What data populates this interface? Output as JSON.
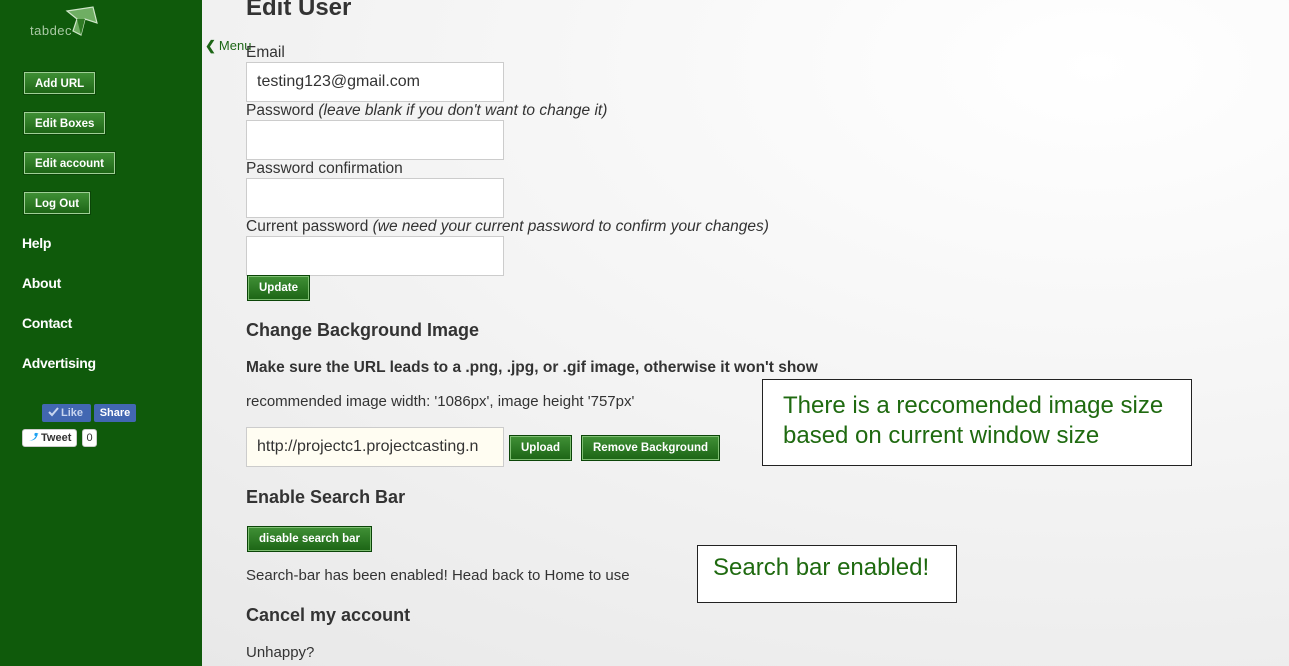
{
  "brand": {
    "logo_text": "tabdec"
  },
  "sidebar": {
    "buttons": [
      {
        "label": "Add URL"
      },
      {
        "label": "Edit Boxes"
      },
      {
        "label": "Edit account"
      },
      {
        "label": "Log Out"
      }
    ],
    "links": [
      {
        "label": "Help"
      },
      {
        "label": "About"
      },
      {
        "label": "Contact"
      },
      {
        "label": "Advertising"
      }
    ],
    "social": {
      "like_label": "Like",
      "share_label": "Share",
      "tweet_label": "Tweet",
      "tweet_count": "0"
    },
    "menu_toggle": {
      "chevron": "❮",
      "label": "Menu"
    }
  },
  "page": {
    "title": "Edit User",
    "email": {
      "label": "Email",
      "value": "testing123@gmail.com"
    },
    "password": {
      "label": "Password",
      "hint": "(leave blank if you don't want to change it)",
      "value": ""
    },
    "password_confirmation": {
      "label": "Password confirmation",
      "value": ""
    },
    "current_password": {
      "label": "Current password",
      "hint": "(we need your current password to confirm your changes)",
      "value": ""
    },
    "update_button": "Update"
  },
  "background": {
    "heading": "Change Background Image",
    "notice": "Make sure the URL leads to a .png, .jpg, or .gif image, otherwise it won't show",
    "recommended": "recommended image width: '1086px', image height '757px'",
    "url_value": "http://projectc1.projectcasting.n",
    "upload_button": "Upload",
    "remove_button": "Remove Background"
  },
  "search_bar": {
    "heading": "Enable Search Bar",
    "toggle_button": "disable search bar",
    "status": "Search-bar has been enabled! Head back to Home to use"
  },
  "cancel": {
    "heading": "Cancel my account",
    "text": "Unhappy?"
  },
  "annotations": {
    "image_size_line1": "There is a reccomended image size",
    "image_size_line2": "based on current window size",
    "search_enabled": "Search bar enabled!"
  },
  "colors": {
    "sidebar_bg": "#0f5a0b",
    "button_green": "#2a7a22",
    "annotation_text": "#1f6a10",
    "facebook_blue": "#4267b2"
  }
}
